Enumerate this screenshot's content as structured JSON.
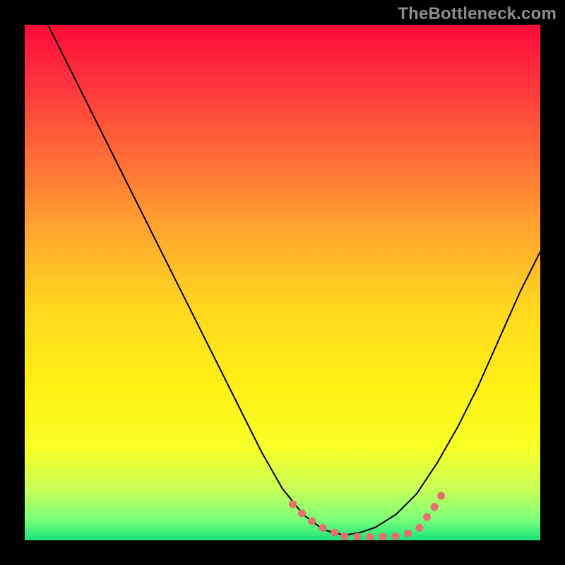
{
  "watermark": "TheBottleneck.com",
  "chart_data": {
    "type": "line",
    "title": "",
    "xlabel": "",
    "ylabel": "",
    "xlim": [
      0,
      100
    ],
    "ylim": [
      0,
      100
    ],
    "gradient_stops": [
      {
        "offset": 0.0,
        "color": "#ff0a3a"
      },
      {
        "offset": 0.1,
        "color": "#ff2f3e"
      },
      {
        "offset": 0.25,
        "color": "#ff6a38"
      },
      {
        "offset": 0.4,
        "color": "#ffa62e"
      },
      {
        "offset": 0.55,
        "color": "#ffd81f"
      },
      {
        "offset": 0.7,
        "color": "#fff015"
      },
      {
        "offset": 0.82,
        "color": "#f7ff26"
      },
      {
        "offset": 0.9,
        "color": "#c9ff55"
      },
      {
        "offset": 0.96,
        "color": "#7aff7a"
      },
      {
        "offset": 1.0,
        "color": "#18e47a"
      }
    ],
    "series": [
      {
        "name": "bottleneck-curve",
        "stroke": "#000000",
        "x": [
          0,
          3,
          6,
          10,
          14,
          18,
          22,
          26,
          30,
          34,
          38,
          42,
          46,
          50,
          54,
          58,
          62,
          65,
          68,
          72,
          76,
          80,
          84,
          88,
          92,
          96,
          100
        ],
        "y": [
          120,
          103,
          97,
          89,
          81,
          73,
          65,
          57,
          49,
          41,
          33,
          25,
          17,
          10,
          5,
          2,
          1,
          1.5,
          2.5,
          5,
          9,
          15,
          22,
          30,
          39,
          48,
          56
        ]
      },
      {
        "name": "highlight-left",
        "stroke": "#e76f6f",
        "x": [
          52,
          54,
          56,
          58,
          60,
          62
        ],
        "y": [
          7,
          5,
          3.5,
          2.3,
          1.5,
          1.2
        ]
      },
      {
        "name": "highlight-bottom",
        "stroke": "#e76f6f",
        "x": [
          62,
          64,
          66,
          68,
          70,
          72,
          74,
          76,
          78
        ],
        "y": [
          0.8,
          0.7,
          0.65,
          0.65,
          0.7,
          0.8,
          1.2,
          2.0,
          3.5
        ]
      },
      {
        "name": "highlight-right",
        "stroke": "#e76f6f",
        "x": [
          78,
          79.5,
          81
        ],
        "y": [
          4.5,
          6.5,
          9.0
        ]
      }
    ]
  }
}
